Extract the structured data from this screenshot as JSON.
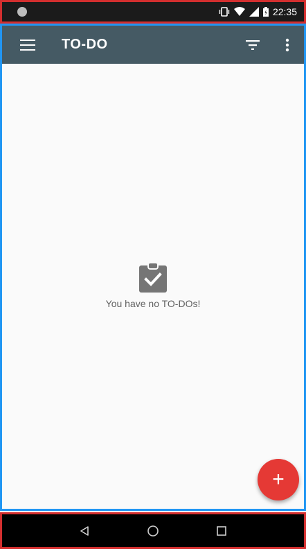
{
  "status_bar": {
    "time": "22:35",
    "icons": [
      "notification-dot-icon",
      "vibrate-icon",
      "wifi-icon",
      "signal-icon",
      "battery-icon"
    ]
  },
  "app_bar": {
    "title": "TO-DO",
    "menu_icon": "hamburger-icon",
    "filter_icon": "filter-icon",
    "overflow_icon": "more-vert-icon"
  },
  "empty_state": {
    "icon": "clipboard-check-icon",
    "message": "You have no TO-DOs!"
  },
  "fab": {
    "label": "+",
    "color": "#e53935"
  },
  "nav_bar": {
    "icons": [
      "back-icon",
      "home-icon",
      "recents-icon"
    ]
  },
  "colors": {
    "app_bar": "#455a64",
    "status_bar": "#1b1b1b",
    "background": "#fafafa",
    "accent": "#e53935"
  }
}
